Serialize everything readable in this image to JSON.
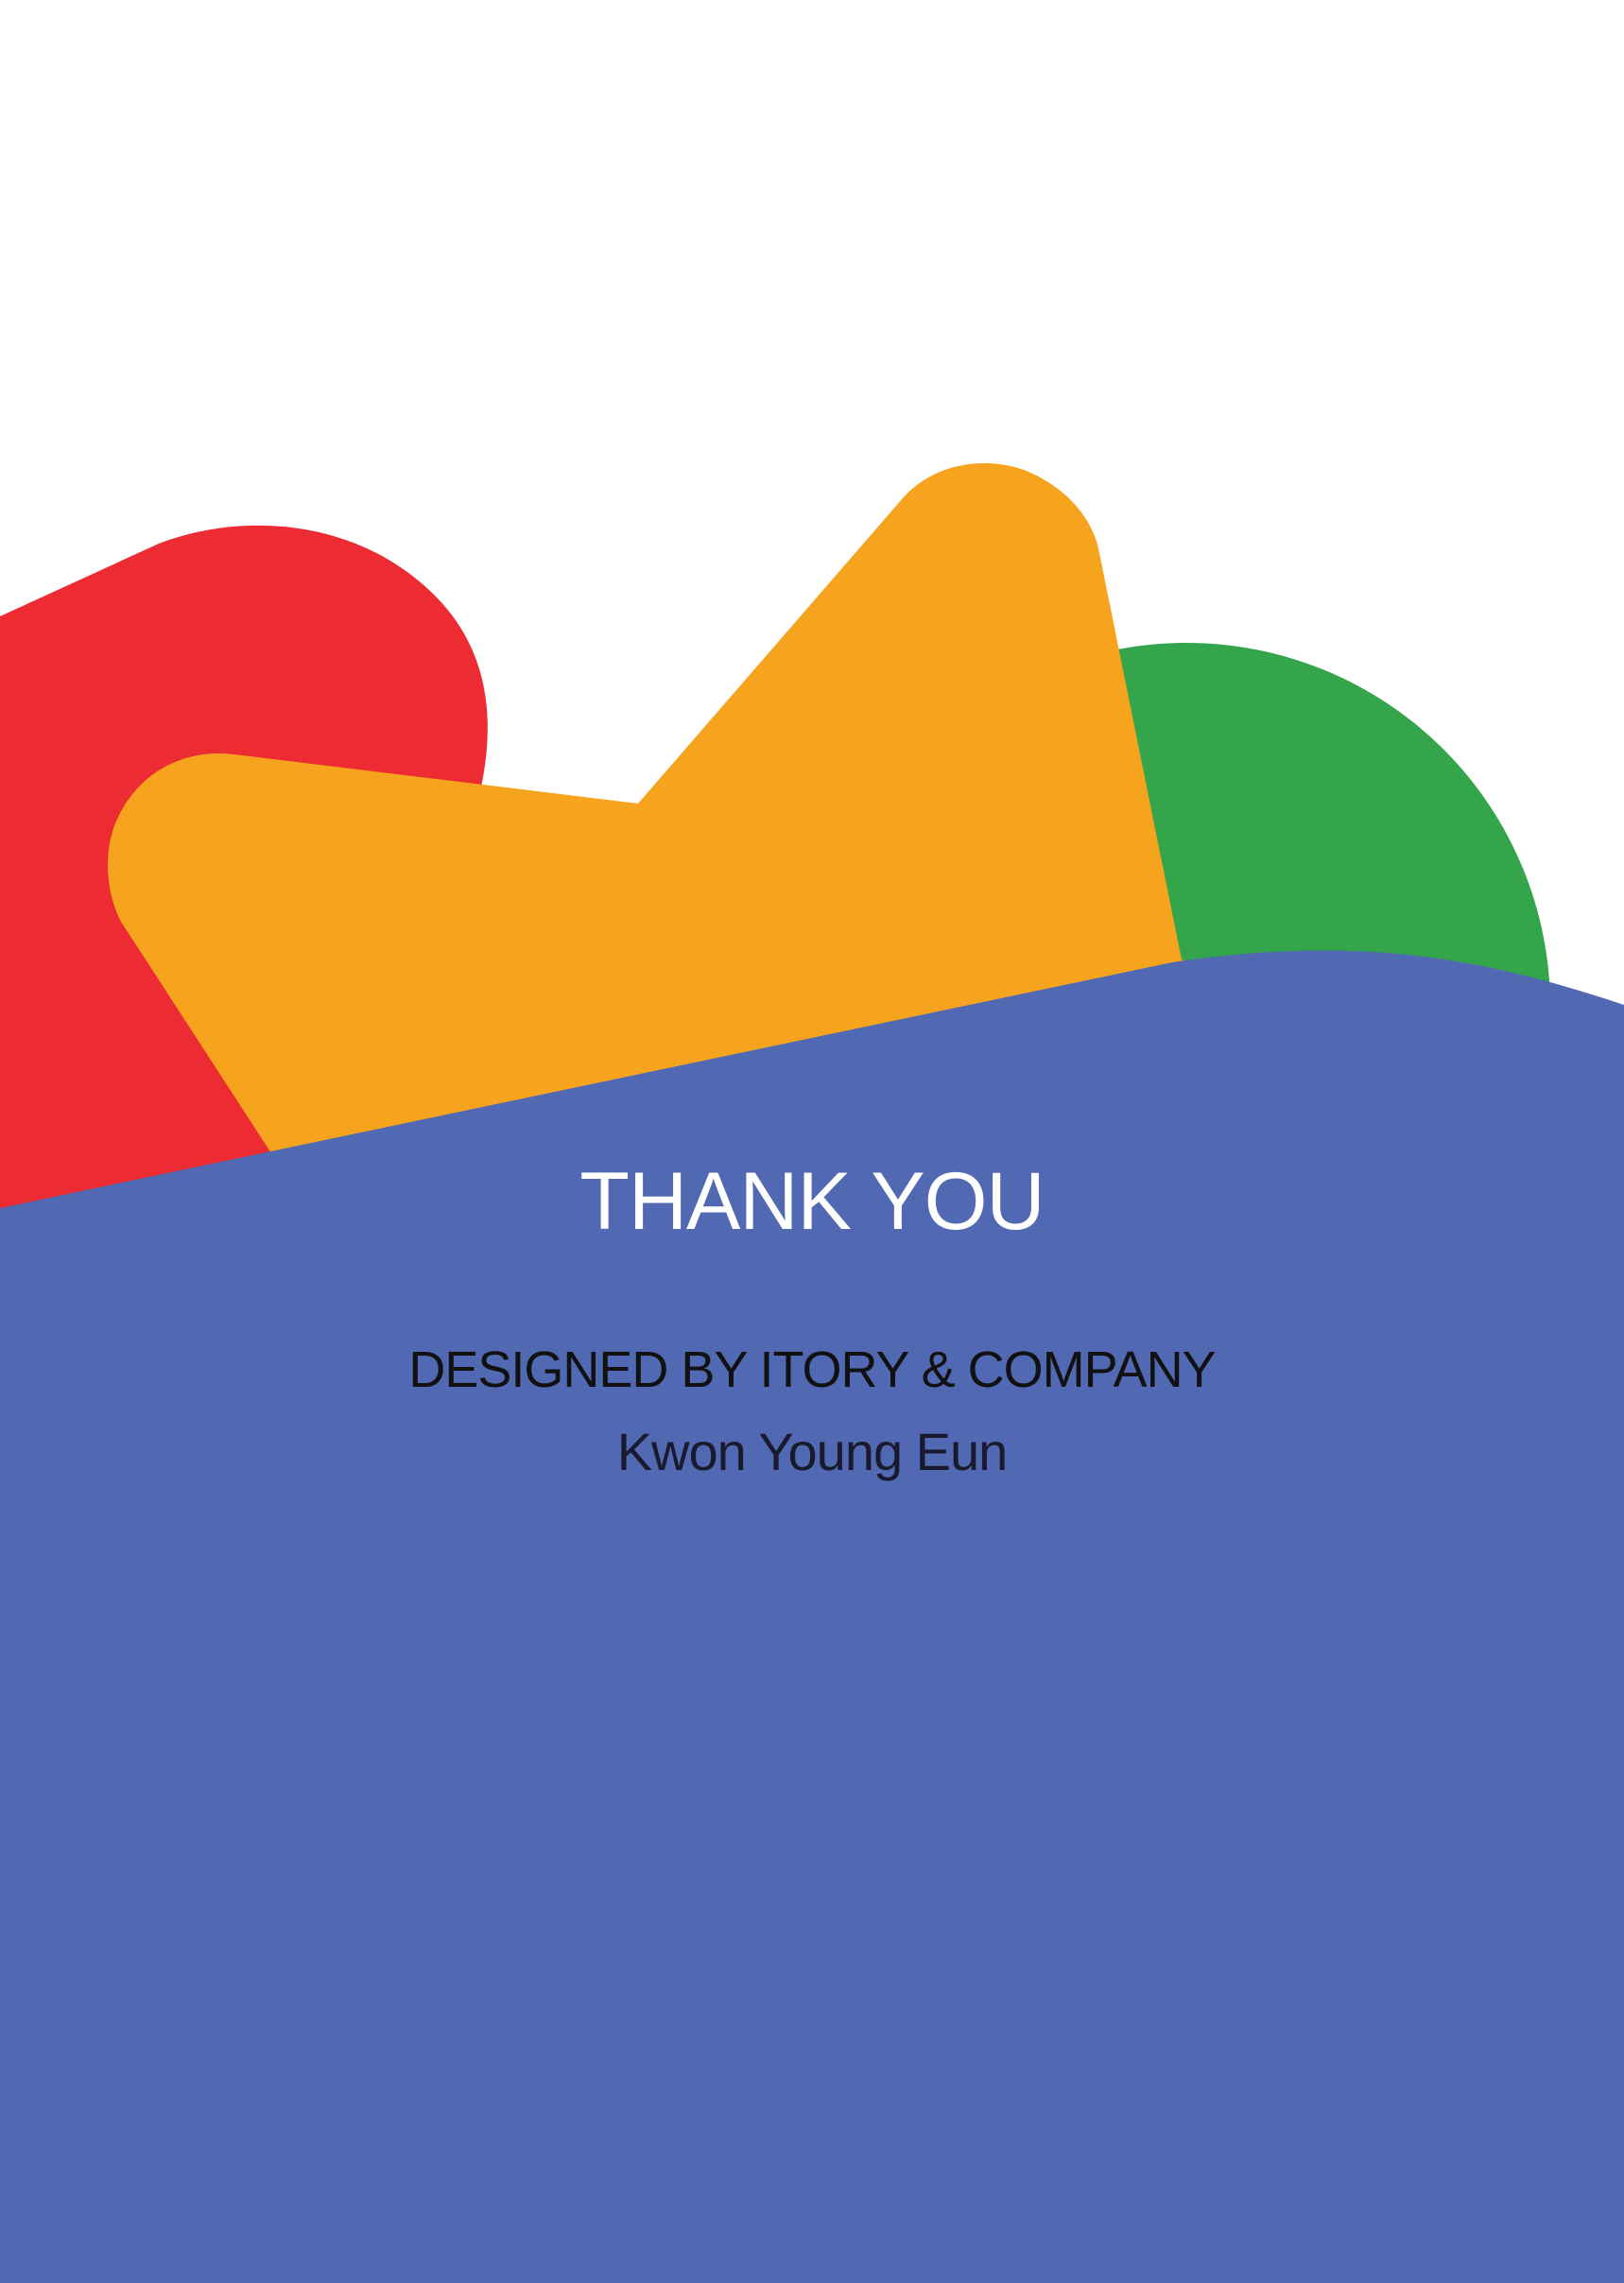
{
  "page": {
    "background": "#ffffff"
  },
  "colors": {
    "red": "#ec2b33",
    "orange": "#f6a31e",
    "green": "#34a54a",
    "blue": "#5069b2",
    "title_text": "#ffffff",
    "body_text": "#111111"
  },
  "content": {
    "title": "THANK YOU",
    "credit": "DESIGNED BY ITORY & COMPANY",
    "author": "Kwon Young Eun"
  }
}
